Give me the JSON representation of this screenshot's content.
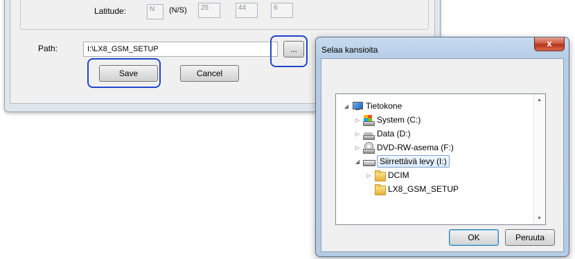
{
  "settings": {
    "latitude_label": "Latitude:",
    "ns_value": "N",
    "ns_hint": "(N/S)",
    "lat_deg": "25",
    "lat_min": "44",
    "lat_sec": "6",
    "path_label": "Path:",
    "path_value": "I:\\LX8_GSM_SETUP",
    "browse_label": "...",
    "save_label": "Save",
    "cancel_label": "Cancel"
  },
  "browser": {
    "title": "Selaa kansioita",
    "close_label": "x",
    "tree": [
      {
        "label": "Tietokone",
        "icon": "computer-icon",
        "toggle": "◢"
      },
      {
        "label": "System (C:)",
        "icon": "windows-drive-icon",
        "toggle": "▷"
      },
      {
        "label": "Data (D:)",
        "icon": "hard-drive-icon",
        "toggle": "▷"
      },
      {
        "label": "DVD-RW-asema (F:)",
        "icon": "dvd-drive-icon",
        "toggle": "▷"
      },
      {
        "label": "Siirrettävä levy (I:)",
        "icon": "removable-drive-icon",
        "toggle": "◢"
      },
      {
        "label": "DCIM",
        "icon": "folder-icon",
        "toggle": "▷"
      },
      {
        "label": "LX8_GSM_SETUP",
        "icon": "folder-icon",
        "toggle": ""
      }
    ],
    "ok_label": "OK",
    "cancel_label": "Peruuta"
  },
  "colors": {
    "highlight": "#1f45c8",
    "close_button": "#c9442a"
  }
}
